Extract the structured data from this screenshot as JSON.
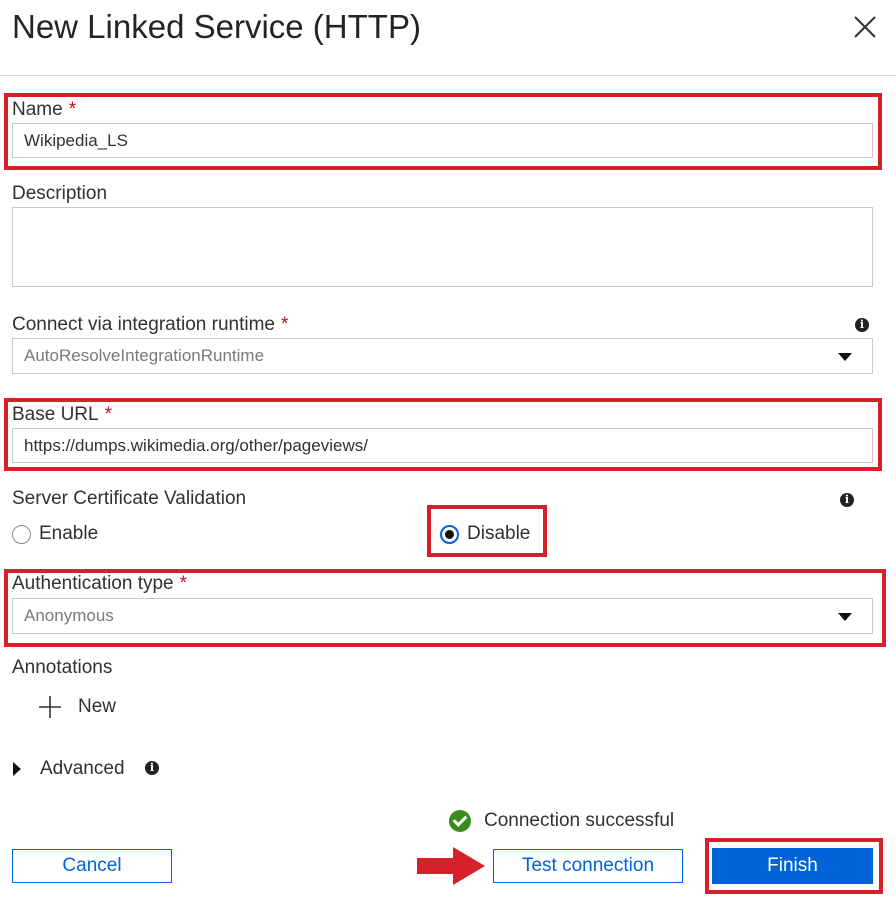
{
  "dialog": {
    "title": "New Linked Service (HTTP)"
  },
  "form": {
    "name": {
      "label": "Name",
      "required_mark": "*",
      "value": "Wikipedia_LS"
    },
    "description": {
      "label": "Description",
      "value": ""
    },
    "runtime": {
      "label": "Connect via integration runtime",
      "required_mark": "*",
      "value": "AutoResolveIntegrationRuntime"
    },
    "base_url": {
      "label": "Base URL",
      "required_mark": "*",
      "value": "https://dumps.wikimedia.org/other/pageviews/"
    },
    "cert_validation": {
      "label": "Server Certificate Validation",
      "options": [
        {
          "label": "Enable",
          "selected": false
        },
        {
          "label": "Disable",
          "selected": true
        }
      ]
    },
    "auth_type": {
      "label": "Authentication type",
      "required_mark": "*",
      "value": "Anonymous"
    },
    "annotations": {
      "label": "Annotations",
      "new_label": "New"
    },
    "advanced": {
      "label": "Advanced"
    }
  },
  "status": {
    "text": "Connection successful"
  },
  "buttons": {
    "cancel": "Cancel",
    "test_connection": "Test connection",
    "finish": "Finish"
  },
  "icons": {
    "close": "close-icon",
    "info": "info-icon",
    "dropdown": "chevron-down-icon",
    "plus": "plus-icon",
    "expand": "caret-right-icon",
    "success": "checkmark-circle-icon",
    "arrow": "red-arrow-icon"
  },
  "colors": {
    "accent": "#0064d6",
    "highlight": "#d6202a",
    "success": "#3a8a1c",
    "required": "#c50f1f"
  }
}
